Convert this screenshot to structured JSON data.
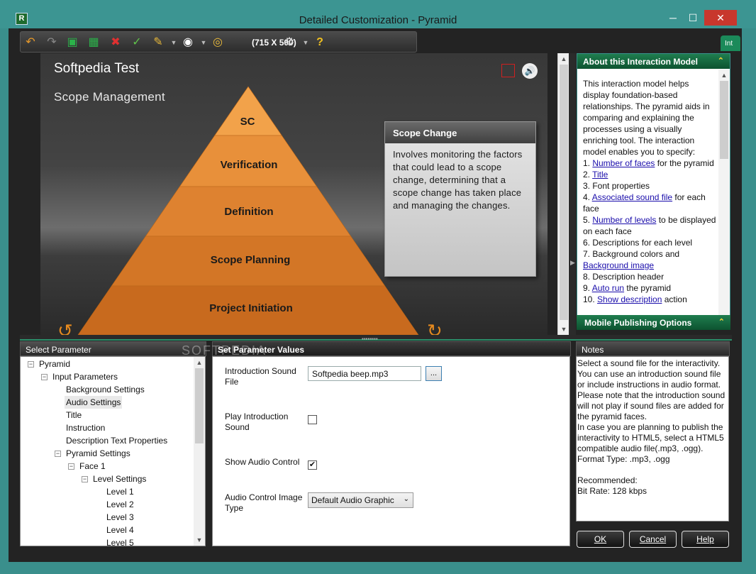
{
  "window": {
    "app_icon": "R",
    "title": "Detailed Customization - Pyramid",
    "minimize": "─",
    "maximize": "☐",
    "close": "✕"
  },
  "toolbar": {
    "dimensions": "(715 X 500)",
    "icons": [
      "undo-icon",
      "redo-icon",
      "save-icon",
      "save-all-icon",
      "delete-icon",
      "spellcheck-icon",
      "palette-icon",
      "preview-icon",
      "target-icon",
      "settings-icon",
      "help-icon"
    ],
    "help_glyph": "?",
    "side_tab": "Int"
  },
  "stage": {
    "title": "Softpedia Test",
    "subtitle": "Scope Management",
    "levels": [
      "SC",
      "Verification",
      "Definition",
      "Scope Planning",
      "Project Initiation"
    ],
    "level_colors": [
      "#f2a24a",
      "#e8903a",
      "#de8230",
      "#d37626",
      "#c86a1e"
    ],
    "description_header": "Scope Change",
    "description_text": "Involves monitoring the factors that could lead to a scope change, determining that a scope change has taken place and managing the changes."
  },
  "about": {
    "header": "About this Interaction Model",
    "intro": "This interaction model helps display foundation-based relationships. The pyramid aids in comparing and explaining the processes using a visually enriching tool. The interaction model enables you to specify:",
    "items": [
      {
        "prefix": "1. ",
        "link": "Number of faces",
        "suffix": " for the pyramid"
      },
      {
        "prefix": "2. ",
        "link": "Title",
        "suffix": ""
      },
      {
        "prefix": "3. Font properties",
        "link": "",
        "suffix": ""
      },
      {
        "prefix": "4. ",
        "link": "Associated sound file",
        "suffix": " for each face"
      },
      {
        "prefix": "5. ",
        "link": "Number of levels",
        "suffix": " to be displayed on each face"
      },
      {
        "prefix": "6. Descriptions for each level",
        "link": "",
        "suffix": ""
      },
      {
        "prefix": "7. Background colors and ",
        "link": "Background image",
        "suffix": ""
      },
      {
        "prefix": "8. Description header",
        "link": "",
        "suffix": ""
      },
      {
        "prefix": "9. ",
        "link": "Auto run",
        "suffix": " the pyramid"
      },
      {
        "prefix": "10. ",
        "link": "Show description",
        "suffix": " action"
      }
    ],
    "mobile_header": "Mobile Publishing Options"
  },
  "panels": {
    "select_parameter": "Select Parameter",
    "set_values": "Set Parameter Values",
    "notes": "Notes"
  },
  "tree": [
    {
      "label": "Pyramid",
      "depth": 0,
      "toggle": "−"
    },
    {
      "label": "Input Parameters",
      "depth": 1,
      "toggle": "−"
    },
    {
      "label": "Background Settings",
      "depth": 2,
      "toggle": ""
    },
    {
      "label": "Audio Settings",
      "depth": 2,
      "toggle": "",
      "selected": true
    },
    {
      "label": "Title",
      "depth": 2,
      "toggle": ""
    },
    {
      "label": "Instruction",
      "depth": 2,
      "toggle": ""
    },
    {
      "label": "Description Text Properties",
      "depth": 2,
      "toggle": ""
    },
    {
      "label": "Pyramid Settings",
      "depth": 2,
      "toggle": "−"
    },
    {
      "label": "Face  1",
      "depth": 3,
      "toggle": "−"
    },
    {
      "label": "Level Settings",
      "depth": 4,
      "toggle": "−"
    },
    {
      "label": "Level  1",
      "depth": 5,
      "toggle": ""
    },
    {
      "label": "Level  2",
      "depth": 5,
      "toggle": ""
    },
    {
      "label": "Level  3",
      "depth": 5,
      "toggle": ""
    },
    {
      "label": "Level  4",
      "depth": 5,
      "toggle": ""
    },
    {
      "label": "Level  5",
      "depth": 5,
      "toggle": ""
    }
  ],
  "params": {
    "intro_sound_label": "Introduction Sound File",
    "intro_sound_value": "Softpedia beep.mp3",
    "browse_label": "...",
    "play_intro_label": "Play Introduction Sound",
    "play_intro_checked": false,
    "show_audio_label": "Show Audio Control",
    "show_audio_checked": true,
    "audio_image_label": "Audio Control Image Type",
    "audio_image_value": "Default Audio Graphic"
  },
  "notes_text": [
    "Select a sound file for the interactivity. You can use an introduction sound file or include instructions in audio format. Please note that the introduction sound will not play if sound files are added for the pyramid faces.",
    "In case you are planning to publish the interactivity to HTML5, select a HTML5 compatible audio file(.mp3, .ogg).",
    "Format Type: .mp3, .ogg",
    "",
    "Recommended:",
    "Bit Rate: 128 kbps"
  ],
  "buttons": {
    "ok": "OK",
    "cancel": "Cancel",
    "help": "Help"
  },
  "watermark": "SOFTPEDIA"
}
